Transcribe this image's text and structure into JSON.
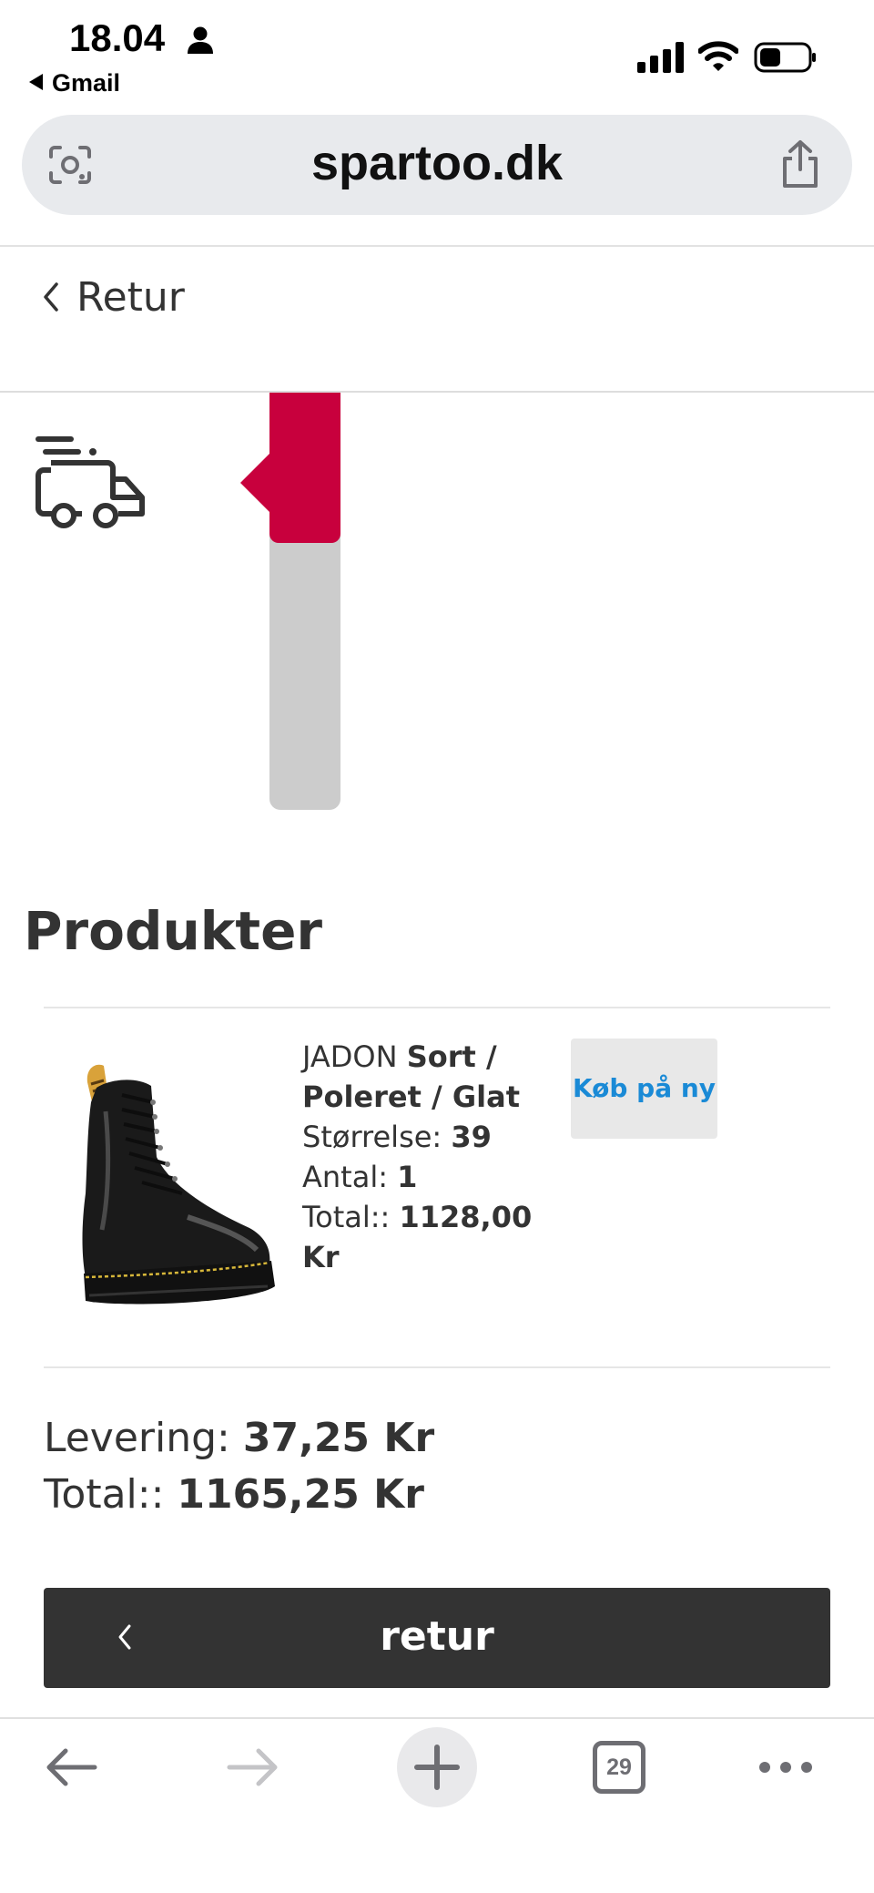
{
  "status_bar": {
    "time": "18.04",
    "back_app": "Gmail"
  },
  "browser": {
    "url": "spartoo.dk",
    "tab_count": "29"
  },
  "nav": {
    "back_label": "Retur"
  },
  "tracking": {
    "progress_fraction": 0.36,
    "accent_color": "#c8003d"
  },
  "products": {
    "title": "Produkter",
    "items": [
      {
        "name": "JADON",
        "variant": "Sort / Poleret / Glat",
        "size_label": "Størrelse:",
        "size": "39",
        "qty_label": "Antal:",
        "qty": "1",
        "total_label": "Total::",
        "total": "1128,00 Kr",
        "buy_again_label": "Køb på ny"
      }
    ]
  },
  "summary": {
    "delivery_label": "Levering:",
    "delivery": "37,25 Kr",
    "total_label": "Total::",
    "total": "1165,25 Kr"
  },
  "footer": {
    "back_button_label": "retur"
  },
  "icons": [
    "person-icon",
    "signal-icon",
    "wifi-icon",
    "battery-icon",
    "lens-icon",
    "share-icon",
    "chevron-left-icon",
    "truck-icon",
    "boot-image",
    "arrow-left-icon",
    "arrow-right-icon",
    "plus-icon",
    "tabs-icon",
    "more-icon"
  ]
}
